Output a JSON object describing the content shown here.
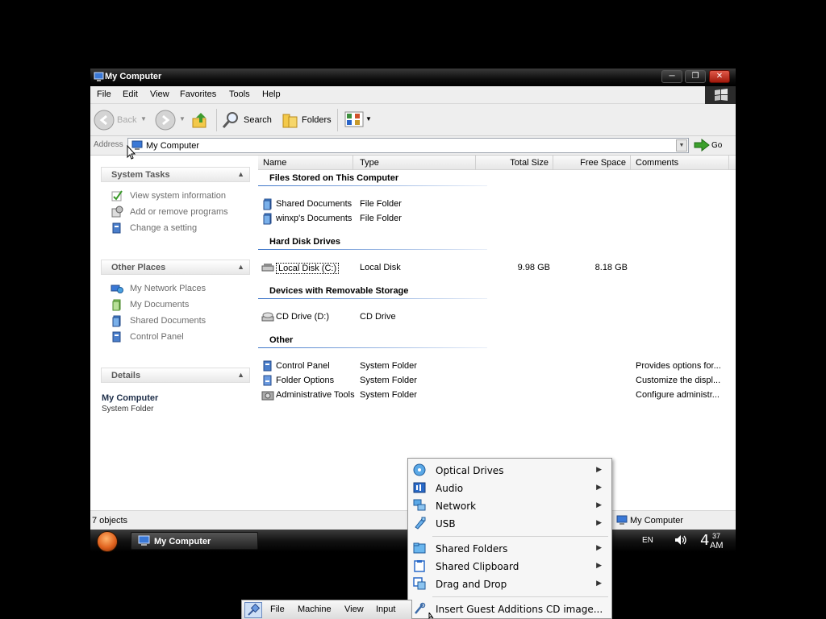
{
  "window": {
    "title": "My Computer",
    "menu": [
      "File",
      "Edit",
      "View",
      "Favorites",
      "Tools",
      "Help"
    ],
    "toolbar": {
      "back_label": "Back",
      "search_label": "Search",
      "folders_label": "Folders"
    },
    "address": {
      "label": "Address",
      "value": "My Computer",
      "go_label": "Go"
    }
  },
  "left_pane": {
    "system_tasks": {
      "title": "System Tasks",
      "items": [
        "View system information",
        "Add or remove programs",
        "Change a setting"
      ]
    },
    "other_places": {
      "title": "Other Places",
      "items": [
        "My Network Places",
        "My Documents",
        "Shared Documents",
        "Control Panel"
      ]
    },
    "details": {
      "title": "Details",
      "name": "My Computer",
      "type": "System Folder"
    }
  },
  "columns": [
    "Name",
    "Type",
    "Total Size",
    "Free Space",
    "Comments"
  ],
  "groups": [
    {
      "title": "Files Stored on This Computer",
      "rows": [
        {
          "name": "Shared Documents",
          "type": "File Folder",
          "total": "",
          "free": "",
          "comments": ""
        },
        {
          "name": "winxp's Documents",
          "type": "File Folder",
          "total": "",
          "free": "",
          "comments": ""
        }
      ]
    },
    {
      "title": "Hard Disk Drives",
      "rows": [
        {
          "name": "Local Disk (C:)",
          "type": "Local Disk",
          "total": "9.98 GB",
          "free": "8.18 GB",
          "comments": ""
        }
      ]
    },
    {
      "title": "Devices with Removable Storage",
      "rows": [
        {
          "name": "CD Drive (D:)",
          "type": "CD Drive",
          "total": "",
          "free": "",
          "comments": ""
        }
      ]
    },
    {
      "title": "Other",
      "rows": [
        {
          "name": "Control Panel",
          "type": "System Folder",
          "total": "",
          "free": "",
          "comments": "Provides options for..."
        },
        {
          "name": "Folder Options",
          "type": "System Folder",
          "total": "",
          "free": "",
          "comments": "Customize the displ..."
        },
        {
          "name": "Administrative Tools",
          "type": "System Folder",
          "total": "",
          "free": "",
          "comments": "Configure administr..."
        }
      ]
    }
  ],
  "status": {
    "left": "7 objects",
    "right": "My Computer"
  },
  "taskbar": {
    "task_label": "My Computer",
    "language": "EN",
    "clock_hour": "4",
    "clock_minute": "37",
    "clock_ampm": "AM"
  },
  "vbox_menu": {
    "items": [
      {
        "label": "Optical Drives",
        "icon": "optical-disc-icon",
        "submenu": true
      },
      {
        "label": "Audio",
        "icon": "audio-icon",
        "submenu": true
      },
      {
        "label": "Network",
        "icon": "network-icon",
        "submenu": true
      },
      {
        "label": "USB",
        "icon": "usb-icon",
        "submenu": true
      },
      {
        "label": "Shared Folders",
        "icon": "shared-folder-icon",
        "submenu": true
      },
      {
        "label": "Shared Clipboard",
        "icon": "clipboard-icon",
        "submenu": true
      },
      {
        "label": "Drag and Drop",
        "icon": "drag-drop-icon",
        "submenu": true
      },
      {
        "label": "Insert Guest Additions CD image...",
        "icon": "guest-additions-icon",
        "submenu": false
      }
    ]
  },
  "vbox_bar": {
    "menus": [
      "File",
      "Machine",
      "View",
      "Input"
    ]
  },
  "colors": {
    "title_bar": "#0d0d0d",
    "group_line": "#3b74c8",
    "menu_bg": "#f6f6f6",
    "start_orb": "#e0621e"
  }
}
